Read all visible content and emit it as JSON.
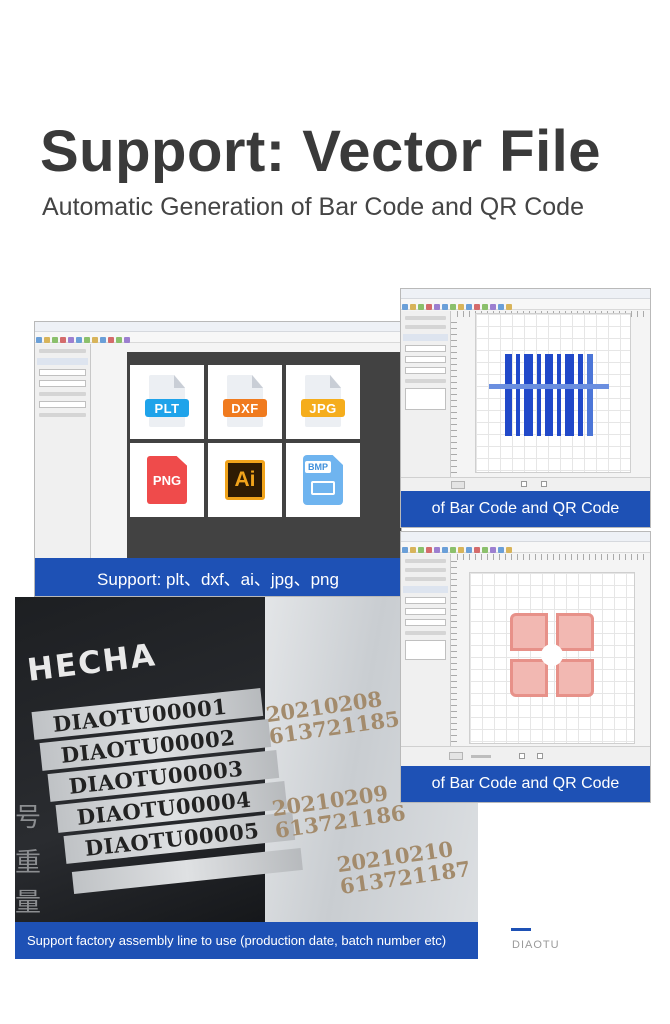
{
  "header": {
    "title": "Support: Vector File",
    "subtitle": "Automatic Generation of Bar Code and QR Code"
  },
  "formats_panel": {
    "caption": "Support: plt、dxf、ai、jpg、png",
    "formats": [
      {
        "label": "PLT",
        "color": "#1fa3ea",
        "icon": "plt-file-icon"
      },
      {
        "label": "DXF",
        "color": "#f07b1f",
        "icon": "dxf-file-icon"
      },
      {
        "label": "JPG",
        "color": "#f5ad1c",
        "icon": "jpg-file-icon"
      },
      {
        "label": "PNG",
        "color": "#ef4b4b",
        "icon": "png-file-icon"
      },
      {
        "label": "Ai",
        "color": "#f0a31b",
        "icon": "ai-file-icon"
      },
      {
        "label": "BMP",
        "color": "#6fb4ef",
        "icon": "bmp-file-icon"
      }
    ]
  },
  "barcode_panel": {
    "caption": "of Bar Code and QR Code"
  },
  "qr_panel": {
    "caption": "of Bar Code and QR Code"
  },
  "photo": {
    "brand": "HECHA",
    "serials": [
      "DIAOTU00001",
      "DIAOTU00002",
      "DIAOTU00003",
      "DIAOTU00004",
      "DIAOTU00005"
    ],
    "dates": [
      {
        "date": "20210208",
        "batch": "613721185"
      },
      {
        "date": "20210209",
        "batch": "613721186"
      },
      {
        "date": "20210210",
        "batch": "613721187"
      }
    ],
    "caption": "Support factory assembly line to use (production date, batch number etc)"
  },
  "footer": {
    "brand": "DIAOTU"
  },
  "colors": {
    "accent_blue": "#1e51b5",
    "barcode_blue": "#2149c9",
    "qr_red": "#e79189"
  }
}
